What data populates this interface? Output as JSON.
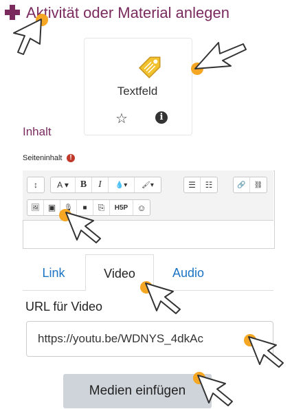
{
  "header": {
    "title": "Aktivität oder Material anlegen"
  },
  "card": {
    "label": "Textfeld",
    "star_glyph": "☆",
    "info_glyph": "i"
  },
  "content": {
    "section_title": "Inhalt",
    "field_label": "Seiteninhalt",
    "required_glyph": "!"
  },
  "toolbar": {
    "row1": [
      {
        "glyph": "↕",
        "name": "collapse-toolbar-icon"
      },
      {
        "glyph": "A ▾",
        "name": "font-size-icon"
      },
      {
        "glyph": "B",
        "name": "bold-icon"
      },
      {
        "glyph": "I",
        "name": "italic-icon"
      },
      {
        "glyph": "💧▾",
        "name": "text-color-icon"
      },
      {
        "glyph": "🖌▾",
        "name": "background-color-icon"
      },
      {
        "glyph": "☰",
        "name": "unordered-list-icon"
      },
      {
        "glyph": "☷",
        "name": "ordered-list-icon"
      },
      {
        "glyph": "🔗",
        "name": "link-icon"
      },
      {
        "glyph": "⛓",
        "name": "unlink-icon"
      }
    ],
    "row2": [
      {
        "glyph": "🖼",
        "name": "image-icon"
      },
      {
        "glyph": "▣",
        "name": "media-icon"
      },
      {
        "glyph": "🎙",
        "name": "record-audio-icon"
      },
      {
        "glyph": "■",
        "name": "record-video-icon"
      },
      {
        "glyph": "⎘",
        "name": "manage-files-icon"
      },
      {
        "glyph": "H5P",
        "name": "h5p-icon"
      },
      {
        "glyph": "☺",
        "name": "emoji-icon"
      }
    ]
  },
  "media_dialog": {
    "tabs": [
      "Link",
      "Video",
      "Audio"
    ],
    "active_tab": "Video",
    "url_label": "URL für Video",
    "url_value": "https://youtu.be/WDNYS_4dkAc",
    "insert_button": "Medien einfügen"
  },
  "colors": {
    "brand": "#7a2a5d",
    "link": "#1a73c4",
    "highlight": "#f5a623",
    "button": "#ced4da"
  }
}
